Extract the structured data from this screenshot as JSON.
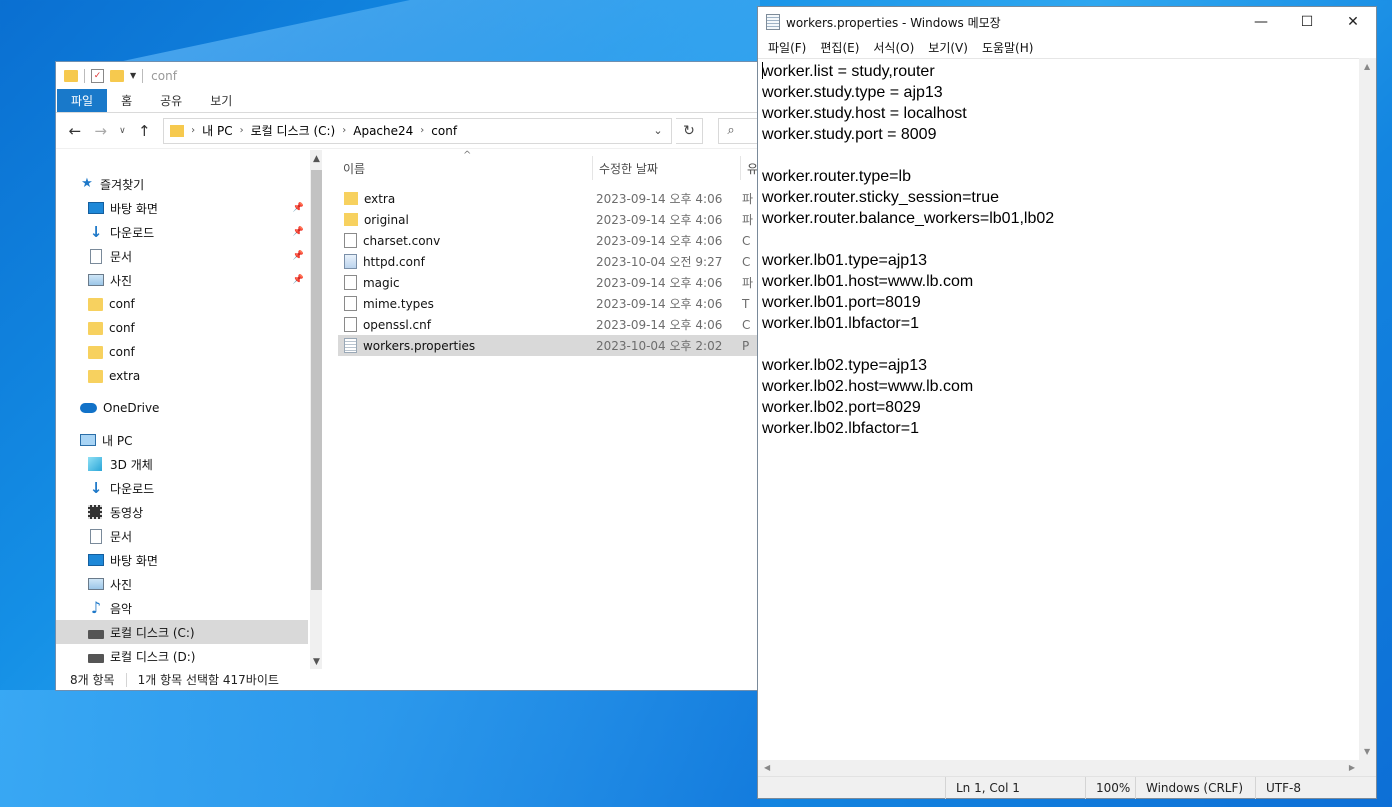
{
  "explorer": {
    "title": "conf",
    "ribbon_tabs": [
      "파일",
      "홈",
      "공유",
      "보기"
    ],
    "breadcrumb": [
      "내 PC",
      "로컬 디스크 (C:)",
      "Apache24",
      "conf"
    ],
    "nav_items": [
      {
        "label": "즐겨찾기",
        "icon": "star-icon",
        "level": 1,
        "pinned": false
      },
      {
        "label": "바탕 화면",
        "icon": "desktop-icon",
        "level": 2,
        "pinned": true
      },
      {
        "label": "다운로드",
        "icon": "download-icon",
        "level": 2,
        "pinned": true
      },
      {
        "label": "문서",
        "icon": "documents-icon",
        "level": 2,
        "pinned": true
      },
      {
        "label": "사진",
        "icon": "pictures-icon",
        "level": 2,
        "pinned": true
      },
      {
        "label": "conf",
        "icon": "folder-icon",
        "level": 2,
        "pinned": false
      },
      {
        "label": "conf",
        "icon": "folder-icon",
        "level": 2,
        "pinned": false
      },
      {
        "label": "conf",
        "icon": "folder-icon",
        "level": 2,
        "pinned": false
      },
      {
        "label": "extra",
        "icon": "folder-icon",
        "level": 2,
        "pinned": false
      },
      {
        "label": "OneDrive",
        "icon": "onedrive-icon",
        "level": 1,
        "pinned": false
      },
      {
        "label": "내 PC",
        "icon": "pc-icon",
        "level": 1,
        "pinned": false
      },
      {
        "label": "3D 개체",
        "icon": "3d-objects-icon",
        "level": 2,
        "pinned": false
      },
      {
        "label": "다운로드",
        "icon": "download-icon",
        "level": 2,
        "pinned": false
      },
      {
        "label": "동영상",
        "icon": "videos-icon",
        "level": 2,
        "pinned": false
      },
      {
        "label": "문서",
        "icon": "documents-icon",
        "level": 2,
        "pinned": false
      },
      {
        "label": "바탕 화면",
        "icon": "desktop-icon",
        "level": 2,
        "pinned": false
      },
      {
        "label": "사진",
        "icon": "pictures-icon",
        "level": 2,
        "pinned": false
      },
      {
        "label": "음악",
        "icon": "music-icon",
        "level": 2,
        "pinned": false
      },
      {
        "label": "로컬 디스크 (C:)",
        "icon": "drive-icon",
        "level": 2,
        "pinned": false,
        "selected": true
      },
      {
        "label": "로컬 디스크 (D:)",
        "icon": "drive-icon",
        "level": 2,
        "pinned": false
      }
    ],
    "columns": {
      "name": "이름",
      "date": "수정한 날짜",
      "type": "유"
    },
    "files": [
      {
        "name": "extra",
        "date": "2023-09-14 오후 4:06",
        "type": "파",
        "icon": "folder-icon"
      },
      {
        "name": "original",
        "date": "2023-09-14 오후 4:06",
        "type": "파",
        "icon": "folder-icon"
      },
      {
        "name": "charset.conv",
        "date": "2023-09-14 오후 4:06",
        "type": "C",
        "icon": "file-icon"
      },
      {
        "name": "httpd.conf",
        "date": "2023-10-04 오전 9:27",
        "type": "C",
        "icon": "config-file-icon"
      },
      {
        "name": "magic",
        "date": "2023-09-14 오후 4:06",
        "type": "파",
        "icon": "file-icon"
      },
      {
        "name": "mime.types",
        "date": "2023-09-14 오후 4:06",
        "type": "T",
        "icon": "file-icon"
      },
      {
        "name": "openssl.cnf",
        "date": "2023-09-14 오후 4:06",
        "type": "C",
        "icon": "file-icon"
      },
      {
        "name": "workers.properties",
        "date": "2023-10-04 오후 2:02",
        "type": "P",
        "icon": "properties-file-icon",
        "selected": true
      }
    ],
    "status": {
      "count": "8개 항목",
      "selection": "1개 항목 선택함 417바이트"
    }
  },
  "notepad": {
    "title": "workers.properties - Windows 메모장",
    "menus": [
      "파일(F)",
      "편집(E)",
      "서식(O)",
      "보기(V)",
      "도움말(H)"
    ],
    "lines": [
      "worker.list = study,router",
      "worker.study.type = ajp13",
      "worker.study.host = localhost",
      "worker.study.port = 8009",
      "",
      "worker.router.type=lb",
      "worker.router.sticky_session=true",
      "worker.router.balance_workers=lb01,lb02",
      "",
      "worker.lb01.type=ajp13",
      "worker.lb01.host=www.lb.com",
      "worker.lb01.port=8019",
      "worker.lb01.lbfactor=1",
      "",
      "worker.lb02.type=ajp13",
      "worker.lb02.host=www.lb.com",
      "worker.lb02.port=8029",
      "worker.lb02.lbfactor=1"
    ],
    "status": {
      "position": "Ln 1, Col 1",
      "zoom": "100%",
      "line_ending": "Windows (CRLF)",
      "encoding": "UTF-8"
    }
  }
}
